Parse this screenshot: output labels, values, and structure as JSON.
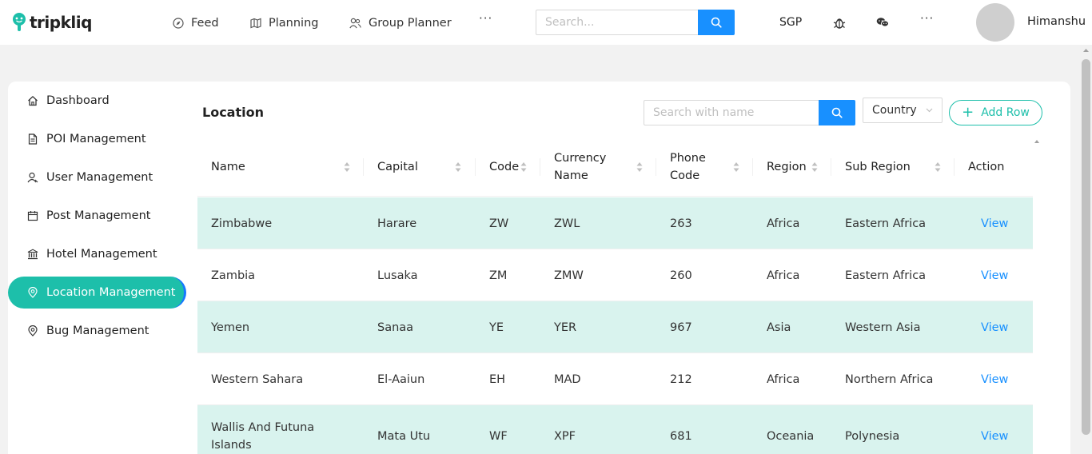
{
  "brand": {
    "name": "tripkliq"
  },
  "nav": {
    "items": [
      {
        "label": "Feed",
        "icon": "compass-icon"
      },
      {
        "label": "Planning",
        "icon": "map-icon"
      },
      {
        "label": "Group Planner",
        "icon": "users-icon"
      }
    ],
    "more": "···",
    "search_placeholder": "Search...",
    "currency": "SGP",
    "user_name": "Himanshu"
  },
  "sidebar": {
    "items": [
      {
        "label": "Dashboard",
        "icon": "home-icon"
      },
      {
        "label": "POI Management",
        "icon": "file-icon"
      },
      {
        "label": "User Management",
        "icon": "user-icon"
      },
      {
        "label": "Post Management",
        "icon": "calendar-icon"
      },
      {
        "label": "Hotel Management",
        "icon": "bank-icon"
      },
      {
        "label": "Location Management",
        "icon": "location-pin-icon",
        "active": true
      },
      {
        "label": "Bug Management",
        "icon": "location-pin-icon"
      }
    ]
  },
  "page": {
    "title": "Location",
    "search_placeholder": "Search with name",
    "filter_label": "Country",
    "add_button": "Add Row"
  },
  "table": {
    "columns": [
      {
        "label": "Name",
        "sortable": true
      },
      {
        "label": "Capital",
        "sortable": true
      },
      {
        "label": "Code",
        "sortable": true
      },
      {
        "label": "Currency Name",
        "sortable": true
      },
      {
        "label": "Phone Code",
        "sortable": true
      },
      {
        "label": "Region",
        "sortable": true
      },
      {
        "label": "Sub Region",
        "sortable": true
      },
      {
        "label": "Action",
        "sortable": false
      }
    ],
    "rows": [
      [
        "Zimbabwe",
        "Harare",
        "ZW",
        "ZWL",
        "263",
        "Africa",
        "Eastern Africa",
        "View"
      ],
      [
        "Zambia",
        "Lusaka",
        "ZM",
        "ZMW",
        "260",
        "Africa",
        "Eastern Africa",
        "View"
      ],
      [
        "Yemen",
        "Sanaa",
        "YE",
        "YER",
        "967",
        "Asia",
        "Western Asia",
        "View"
      ],
      [
        "Western Sahara",
        "El-Aaiun",
        "EH",
        "MAD",
        "212",
        "Africa",
        "Northern Africa",
        "View"
      ],
      [
        "Wallis And Futuna Islands",
        "Mata Utu",
        "WF",
        "XPF",
        "681",
        "Oceania",
        "Polynesia",
        "View"
      ]
    ]
  },
  "colors": {
    "accent": "#1dbfaa",
    "row_highlight": "#d9f3ee",
    "primary_button": "#1890ff",
    "link": "#1890ff"
  }
}
